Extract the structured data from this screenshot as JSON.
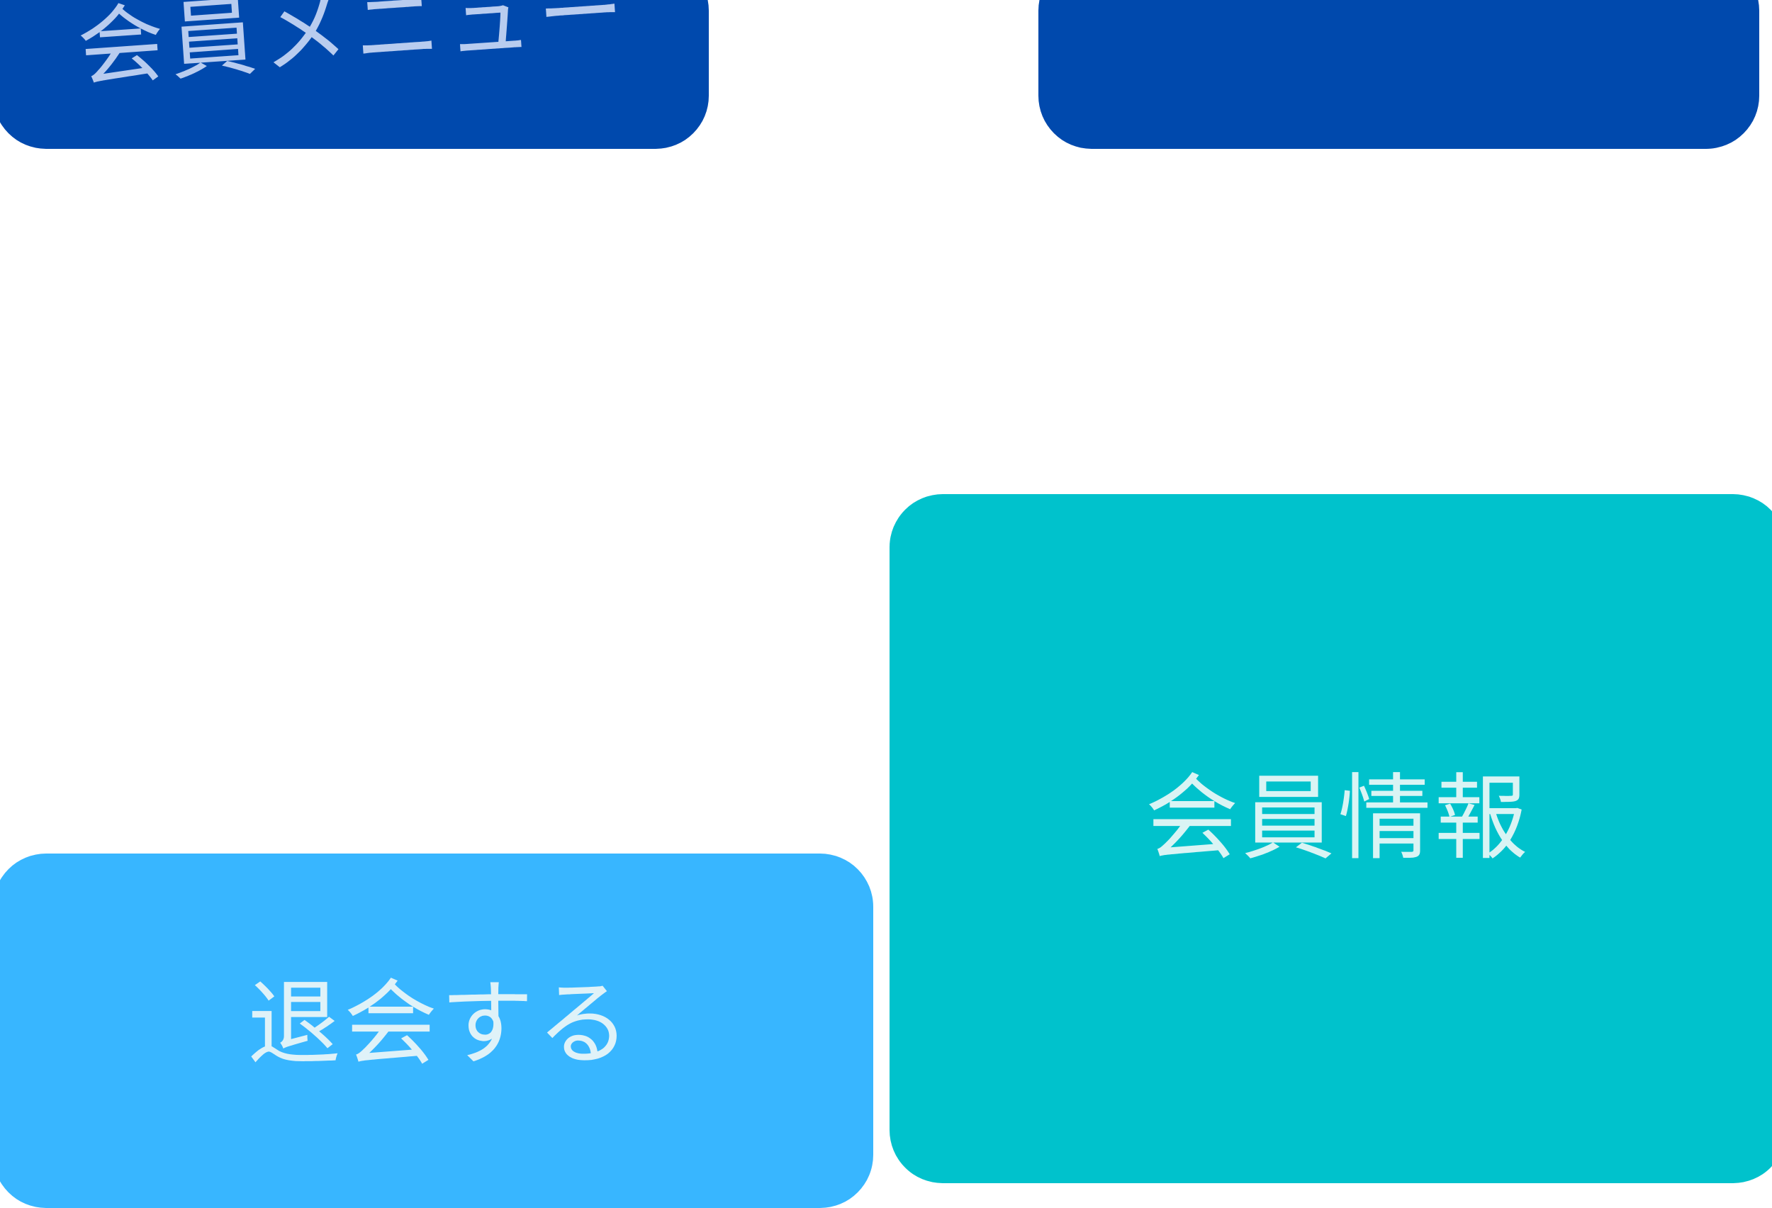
{
  "header": {
    "title": "会員メニュー"
  },
  "buttons": {
    "member_info": "会員情報",
    "withdraw": "退会する"
  },
  "colors": {
    "menu_bg": "#0049ad",
    "menu_text": "#b8ccef",
    "bar_bg": "#0049ad",
    "info_bg": "#00c2cc",
    "info_text": "#d9f4f4",
    "withdraw_bg": "#38b6ff",
    "withdraw_text": "#dff2f8"
  }
}
